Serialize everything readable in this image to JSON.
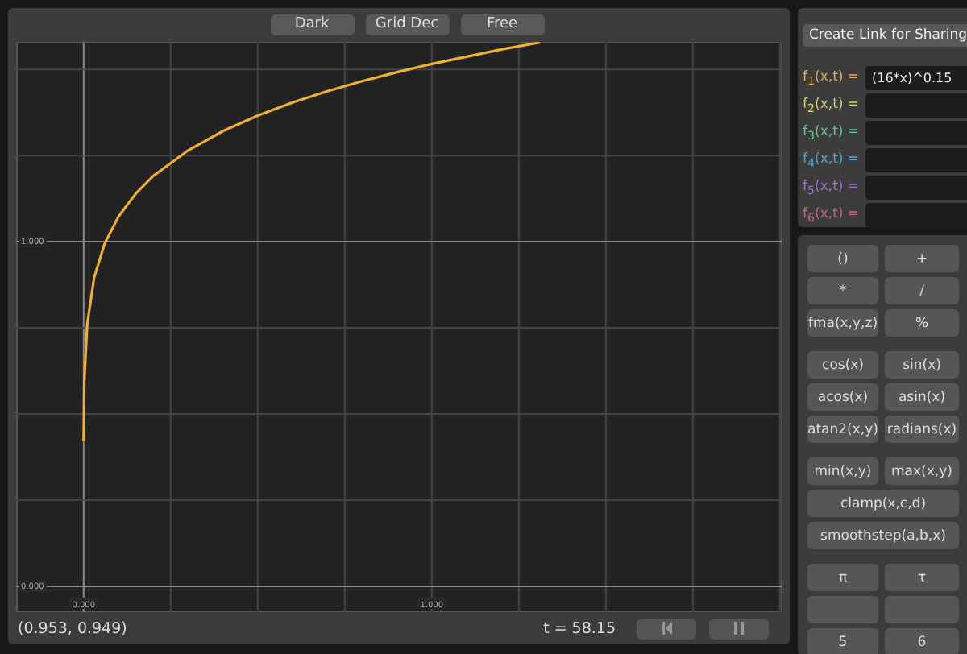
{
  "toolbar": {
    "buttons": [
      {
        "label": "Dark"
      },
      {
        "label": "Grid Dec"
      },
      {
        "label": "Free"
      }
    ]
  },
  "graph": {
    "chart_data": {
      "type": "line",
      "grid": true,
      "xlim": [
        -0.194,
        2.005
      ],
      "ylim": [
        -0.075,
        1.58
      ],
      "xticks": [
        {
          "value": 0,
          "label": "0.000"
        },
        {
          "value": 1,
          "label": "1.000"
        }
      ],
      "yticks": [
        {
          "value": 0,
          "label": "0.000"
        },
        {
          "value": 1,
          "label": "1.000"
        }
      ],
      "x": [
        0.0002,
        0.0003,
        0.002,
        0.01,
        0.03,
        0.06,
        0.1,
        0.15,
        0.2,
        0.3,
        0.4,
        0.5,
        0.6,
        0.7,
        0.8,
        0.9,
        1.0,
        1.1,
        1.2,
        1.31
      ],
      "series": [
        {
          "color": "#f0b030",
          "values": [
            0.422,
            0.449,
            0.597,
            0.76,
            0.896,
            0.994,
            1.073,
            1.14,
            1.191,
            1.265,
            1.321,
            1.366,
            1.404,
            1.437,
            1.466,
            1.492,
            1.516,
            1.537,
            1.558,
            1.578
          ]
        }
      ]
    }
  },
  "status_bar": {
    "coordinates": "(0.953, 0.949)",
    "time": "t = 58.15"
  },
  "share_button": "Create Link for Sharing",
  "functions": [
    {
      "label": "f$_{1}$(x,t) =",
      "color": "#e8a84a",
      "value": "(16*x)^0.15"
    },
    {
      "label": "f$_{2}$(x,t) =",
      "color": "#d8d060"
    },
    {
      "label": "f$_{3}$(x,t) =",
      "color": "#60c890"
    },
    {
      "label": "f$_{4}$(x,t) =",
      "color": "#4aa8d8"
    },
    {
      "label": "f$_{5}$(x,t) =",
      "color": "#a070d0"
    },
    {
      "label": "f$_{6}$(x,t) =",
      "color": "#d06080"
    }
  ],
  "key_groups": [
    [
      {
        "kind": "normal",
        "label": "()"
      },
      {
        "kind": "normal",
        "label": "+"
      },
      {
        "kind": "normal",
        "label": "*"
      },
      {
        "kind": "normal",
        "label": "/"
      },
      {
        "kind": "normal",
        "label": "fma(x,y,z)"
      },
      {
        "kind": "normal",
        "label": "%"
      }
    ],
    [
      {
        "kind": "normal",
        "label": "cos(x)"
      },
      {
        "kind": "normal",
        "label": "sin(x)"
      },
      {
        "kind": "normal",
        "label": "acos(x)"
      },
      {
        "kind": "normal",
        "label": "asin(x)"
      },
      {
        "kind": "normal",
        "label": "atan2(x,y)"
      },
      {
        "kind": "normal",
        "label": "radians(x)"
      }
    ],
    [
      {
        "kind": "normal",
        "label": "min(x,y)"
      },
      {
        "kind": "normal",
        "label": "max(x,y)"
      },
      {
        "kind": "wide",
        "label": "clamp(x,c,d)"
      },
      {
        "kind": "wide",
        "label": "smoothstep(a,b,x)"
      }
    ],
    [
      {
        "kind": "normal",
        "label": "π"
      },
      {
        "kind": "normal",
        "label": "τ"
      },
      {
        "kind": "blank"
      },
      {
        "kind": "blank"
      },
      {
        "kind": "normal",
        "label": "5"
      },
      {
        "kind": "normal",
        "label": "6"
      }
    ]
  ]
}
